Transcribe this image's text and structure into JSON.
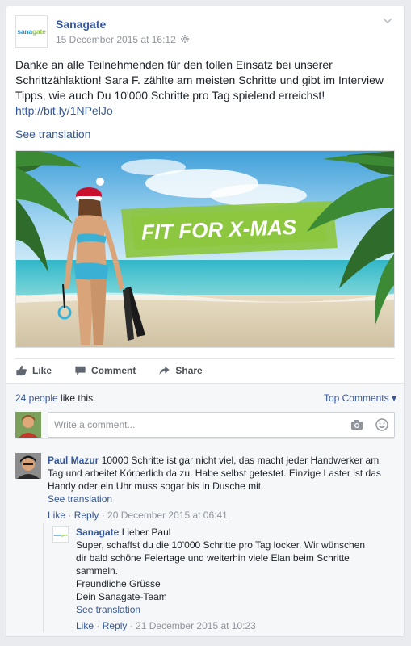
{
  "post": {
    "page_name": "Sanagate",
    "logo_text_a": "sana",
    "logo_text_b": "gate",
    "timestamp": "15 December 2015 at 16:12",
    "body": "Danke an alle Teilnehmenden für den tollen Einsatz bei unserer Schrittzählaktion! Sara F. zählte am meisten Schritte und gibt im Interview Tipps, wie auch Du 10'000 Schritte pro Tag spielend erreichst!",
    "link": "http://bit.ly/1NPelJo",
    "see_translation": "See translation",
    "image_banner": "FIT FOR X-MAS"
  },
  "actions": {
    "like": "Like",
    "comment": "Comment",
    "share": "Share"
  },
  "likes": {
    "count_link": "24 people",
    "suffix": " like this."
  },
  "sort": {
    "label": "Top Comments ▾"
  },
  "composer": {
    "placeholder": "Write a comment..."
  },
  "comments": [
    {
      "author": "Paul Mazur",
      "text": " 10000 Schritte ist gar nicht viel, das macht jeder Handwerker am Tag und arbeitet Körperlich da zu. Habe selbst getestet. Einzige Laster ist das Handy oder ein Uhr muss sogar bis in Dusche mit.",
      "see_translation": "See translation",
      "like": "Like",
      "reply": "Reply",
      "time": "20 December 2015 at 06:41"
    }
  ],
  "reply": {
    "author": "Sanagate",
    "line1": " Lieber Paul",
    "line2": "Super, schaffst du die 10'000 Schritte pro Tag locker. Wir wünschen dir bald schöne Feiertage und weiterhin viele Elan beim Schritte sammeln.",
    "line3": "Freundliche Grüsse",
    "line4": "Dein Sanagate-Team",
    "see_translation": "See translation",
    "like": "Like",
    "reply": "Reply",
    "time": "21 December 2015 at 10:23"
  },
  "colors": {
    "link": "#365899",
    "meta": "#90949c",
    "banner": "#8dc63f"
  }
}
